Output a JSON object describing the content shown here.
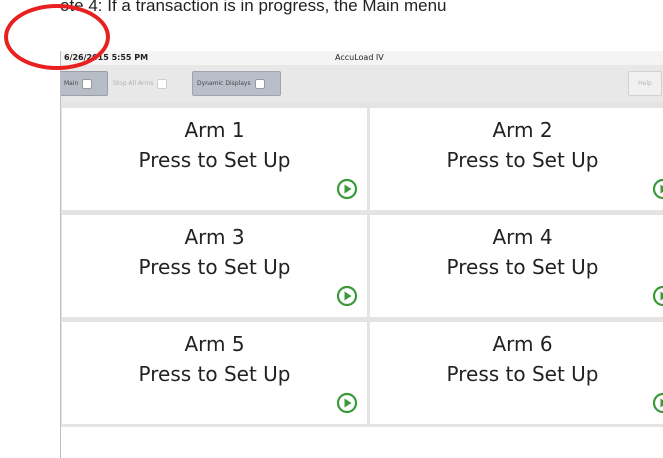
{
  "caption": {
    "text": "ote 4: If a transaction is in progress, the Main menu"
  },
  "statusbar": {
    "datetime": "6/26/2015  5:55 PM",
    "title": "AccuLoad IV"
  },
  "toolbar": {
    "main_label": "Main",
    "stop_label": "Stop All Arms",
    "dynamic_label": "Dynamic Displays",
    "help_label": "Help"
  },
  "arms": [
    {
      "name": "Arm 1",
      "status": "Press to Set Up"
    },
    {
      "name": "Arm 2",
      "status": "Press to Set Up"
    },
    {
      "name": "Arm 3",
      "status": "Press to Set Up"
    },
    {
      "name": "Arm 4",
      "status": "Press to Set Up"
    },
    {
      "name": "Arm 5",
      "status": "Press to Set Up"
    },
    {
      "name": "Arm 6",
      "status": "Press to Set Up"
    }
  ],
  "icons": {
    "play": "play-circle-icon",
    "checkbox": "checkbox-icon"
  },
  "colors": {
    "play": "#3a9a3a",
    "highlight_circle": "#e8201f"
  }
}
